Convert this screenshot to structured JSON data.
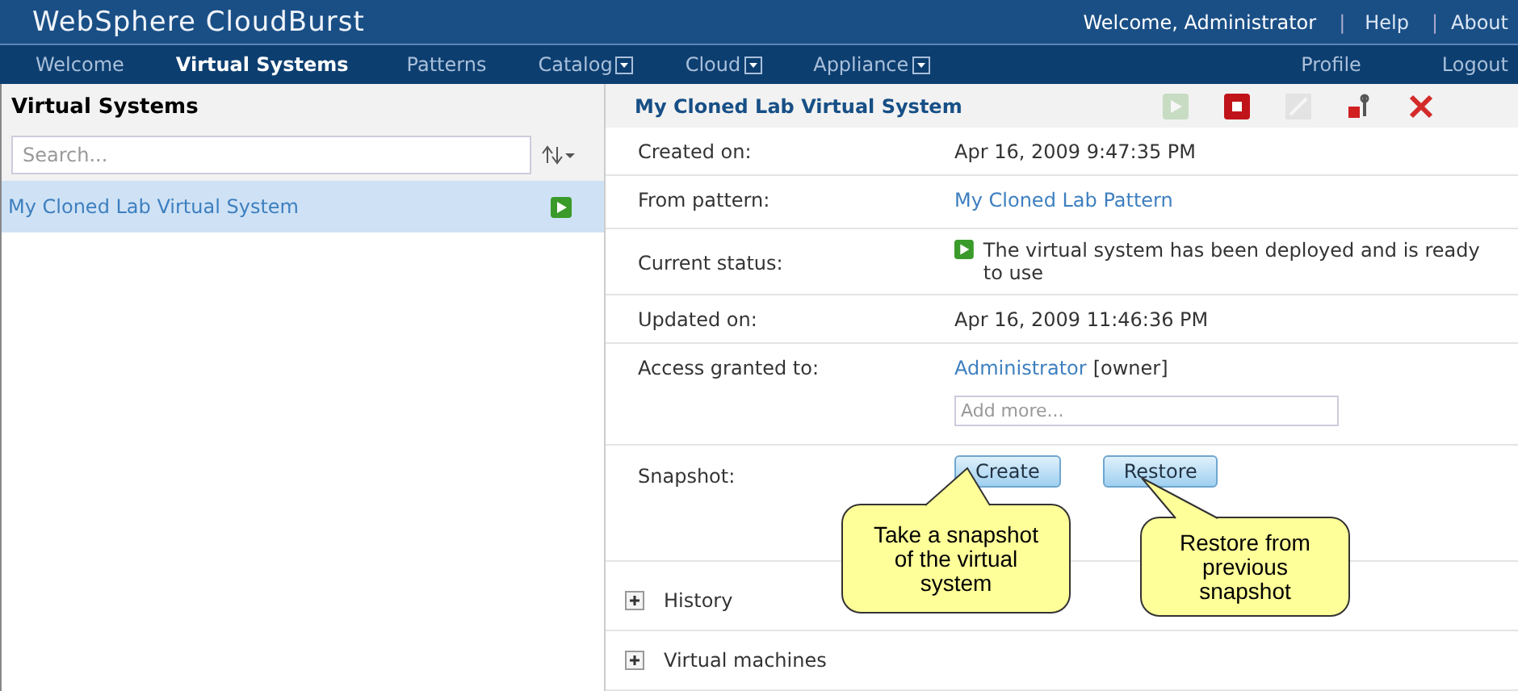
{
  "header": {
    "title": "WebSphere CloudBurst",
    "user": "Welcome, Administrator",
    "separator": "|",
    "links": [
      "Help",
      "About"
    ]
  },
  "nav": {
    "items": [
      {
        "label": "Welcome",
        "selected": false,
        "dropdown": false
      },
      {
        "label": "Virtual Systems",
        "selected": true,
        "dropdown": false
      },
      {
        "label": "Patterns",
        "selected": false,
        "dropdown": false
      },
      {
        "label": "Catalog",
        "selected": false,
        "dropdown": true
      },
      {
        "label": "Cloud",
        "selected": false,
        "dropdown": true
      },
      {
        "label": "Appliance",
        "selected": false,
        "dropdown": true
      }
    ],
    "right": [
      "Profile",
      "Logout"
    ]
  },
  "list_panel": {
    "title": "Virtual Systems",
    "search": {
      "placeholder": "Search..."
    },
    "items": [
      {
        "label": "My Cloned Lab Virtual System",
        "selected": true,
        "running": true
      }
    ]
  },
  "detail": {
    "title": "My Cloned Lab Virtual System",
    "toolbar": [
      {
        "kind": "start",
        "disabled": true
      },
      {
        "kind": "stop",
        "disabled": false
      },
      {
        "kind": "edit",
        "disabled": true
      },
      {
        "kind": "configure",
        "disabled": false
      },
      {
        "kind": "delete",
        "disabled": false
      }
    ],
    "fields": [
      {
        "kind": "text",
        "label": "Created on:",
        "value": "Apr 16, 2009 9:47:35 PM"
      },
      {
        "kind": "link",
        "label": "From pattern:",
        "value": "My Cloned Lab Pattern"
      },
      {
        "kind": "status",
        "label": "Current status:",
        "value": "The virtual system has been deployed and is ready to use",
        "running": true
      },
      {
        "kind": "text",
        "label": "Updated on:",
        "value": "Apr 16, 2009 11:46:36 PM"
      },
      {
        "kind": "access",
        "label": "Access granted to:",
        "value": "Administrator",
        "suffix": "[owner]",
        "placeholder": "Add more..."
      },
      {
        "kind": "buttons",
        "label": "Snapshot:",
        "buttons": [
          "Create",
          "Restore"
        ]
      }
    ],
    "sections": [
      {
        "label": "History",
        "expanded": false
      },
      {
        "label": "Virtual machines",
        "expanded": false
      }
    ]
  },
  "callouts": [
    {
      "text": "Take a snapshot of the virtual system"
    },
    {
      "text": "Restore from previous snapshot"
    }
  ]
}
